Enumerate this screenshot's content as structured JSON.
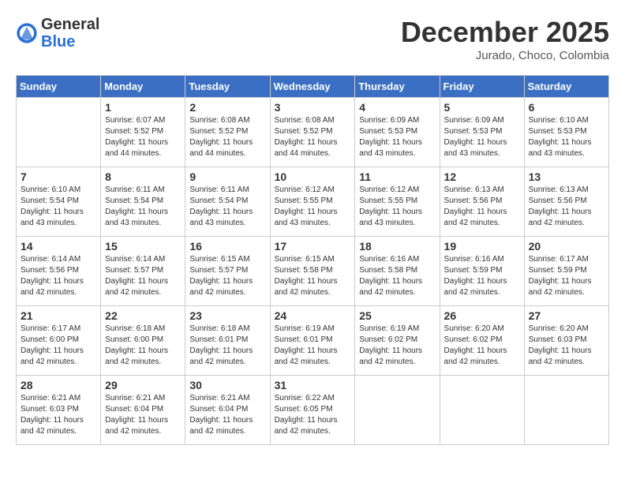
{
  "header": {
    "logo": {
      "general": "General",
      "blue": "Blue"
    },
    "title": "December 2025",
    "subtitle": "Jurado, Choco, Colombia"
  },
  "calendar": {
    "days_of_week": [
      "Sunday",
      "Monday",
      "Tuesday",
      "Wednesday",
      "Thursday",
      "Friday",
      "Saturday"
    ],
    "weeks": [
      [
        {
          "day": "",
          "info": ""
        },
        {
          "day": "1",
          "info": "Sunrise: 6:07 AM\nSunset: 5:52 PM\nDaylight: 11 hours and 44 minutes."
        },
        {
          "day": "2",
          "info": "Sunrise: 6:08 AM\nSunset: 5:52 PM\nDaylight: 11 hours and 44 minutes."
        },
        {
          "day": "3",
          "info": "Sunrise: 6:08 AM\nSunset: 5:52 PM\nDaylight: 11 hours and 44 minutes."
        },
        {
          "day": "4",
          "info": "Sunrise: 6:09 AM\nSunset: 5:53 PM\nDaylight: 11 hours and 43 minutes."
        },
        {
          "day": "5",
          "info": "Sunrise: 6:09 AM\nSunset: 5:53 PM\nDaylight: 11 hours and 43 minutes."
        },
        {
          "day": "6",
          "info": "Sunrise: 6:10 AM\nSunset: 5:53 PM\nDaylight: 11 hours and 43 minutes."
        }
      ],
      [
        {
          "day": "7",
          "info": "Sunrise: 6:10 AM\nSunset: 5:54 PM\nDaylight: 11 hours and 43 minutes."
        },
        {
          "day": "8",
          "info": "Sunrise: 6:11 AM\nSunset: 5:54 PM\nDaylight: 11 hours and 43 minutes."
        },
        {
          "day": "9",
          "info": "Sunrise: 6:11 AM\nSunset: 5:54 PM\nDaylight: 11 hours and 43 minutes."
        },
        {
          "day": "10",
          "info": "Sunrise: 6:12 AM\nSunset: 5:55 PM\nDaylight: 11 hours and 43 minutes."
        },
        {
          "day": "11",
          "info": "Sunrise: 6:12 AM\nSunset: 5:55 PM\nDaylight: 11 hours and 43 minutes."
        },
        {
          "day": "12",
          "info": "Sunrise: 6:13 AM\nSunset: 5:56 PM\nDaylight: 11 hours and 42 minutes."
        },
        {
          "day": "13",
          "info": "Sunrise: 6:13 AM\nSunset: 5:56 PM\nDaylight: 11 hours and 42 minutes."
        }
      ],
      [
        {
          "day": "14",
          "info": "Sunrise: 6:14 AM\nSunset: 5:56 PM\nDaylight: 11 hours and 42 minutes."
        },
        {
          "day": "15",
          "info": "Sunrise: 6:14 AM\nSunset: 5:57 PM\nDaylight: 11 hours and 42 minutes."
        },
        {
          "day": "16",
          "info": "Sunrise: 6:15 AM\nSunset: 5:57 PM\nDaylight: 11 hours and 42 minutes."
        },
        {
          "day": "17",
          "info": "Sunrise: 6:15 AM\nSunset: 5:58 PM\nDaylight: 11 hours and 42 minutes."
        },
        {
          "day": "18",
          "info": "Sunrise: 6:16 AM\nSunset: 5:58 PM\nDaylight: 11 hours and 42 minutes."
        },
        {
          "day": "19",
          "info": "Sunrise: 6:16 AM\nSunset: 5:59 PM\nDaylight: 11 hours and 42 minutes."
        },
        {
          "day": "20",
          "info": "Sunrise: 6:17 AM\nSunset: 5:59 PM\nDaylight: 11 hours and 42 minutes."
        }
      ],
      [
        {
          "day": "21",
          "info": "Sunrise: 6:17 AM\nSunset: 6:00 PM\nDaylight: 11 hours and 42 minutes."
        },
        {
          "day": "22",
          "info": "Sunrise: 6:18 AM\nSunset: 6:00 PM\nDaylight: 11 hours and 42 minutes."
        },
        {
          "day": "23",
          "info": "Sunrise: 6:18 AM\nSunset: 6:01 PM\nDaylight: 11 hours and 42 minutes."
        },
        {
          "day": "24",
          "info": "Sunrise: 6:19 AM\nSunset: 6:01 PM\nDaylight: 11 hours and 42 minutes."
        },
        {
          "day": "25",
          "info": "Sunrise: 6:19 AM\nSunset: 6:02 PM\nDaylight: 11 hours and 42 minutes."
        },
        {
          "day": "26",
          "info": "Sunrise: 6:20 AM\nSunset: 6:02 PM\nDaylight: 11 hours and 42 minutes."
        },
        {
          "day": "27",
          "info": "Sunrise: 6:20 AM\nSunset: 6:03 PM\nDaylight: 11 hours and 42 minutes."
        }
      ],
      [
        {
          "day": "28",
          "info": "Sunrise: 6:21 AM\nSunset: 6:03 PM\nDaylight: 11 hours and 42 minutes."
        },
        {
          "day": "29",
          "info": "Sunrise: 6:21 AM\nSunset: 6:04 PM\nDaylight: 11 hours and 42 minutes."
        },
        {
          "day": "30",
          "info": "Sunrise: 6:21 AM\nSunset: 6:04 PM\nDaylight: 11 hours and 42 minutes."
        },
        {
          "day": "31",
          "info": "Sunrise: 6:22 AM\nSunset: 6:05 PM\nDaylight: 11 hours and 42 minutes."
        },
        {
          "day": "",
          "info": ""
        },
        {
          "day": "",
          "info": ""
        },
        {
          "day": "",
          "info": ""
        }
      ]
    ]
  }
}
